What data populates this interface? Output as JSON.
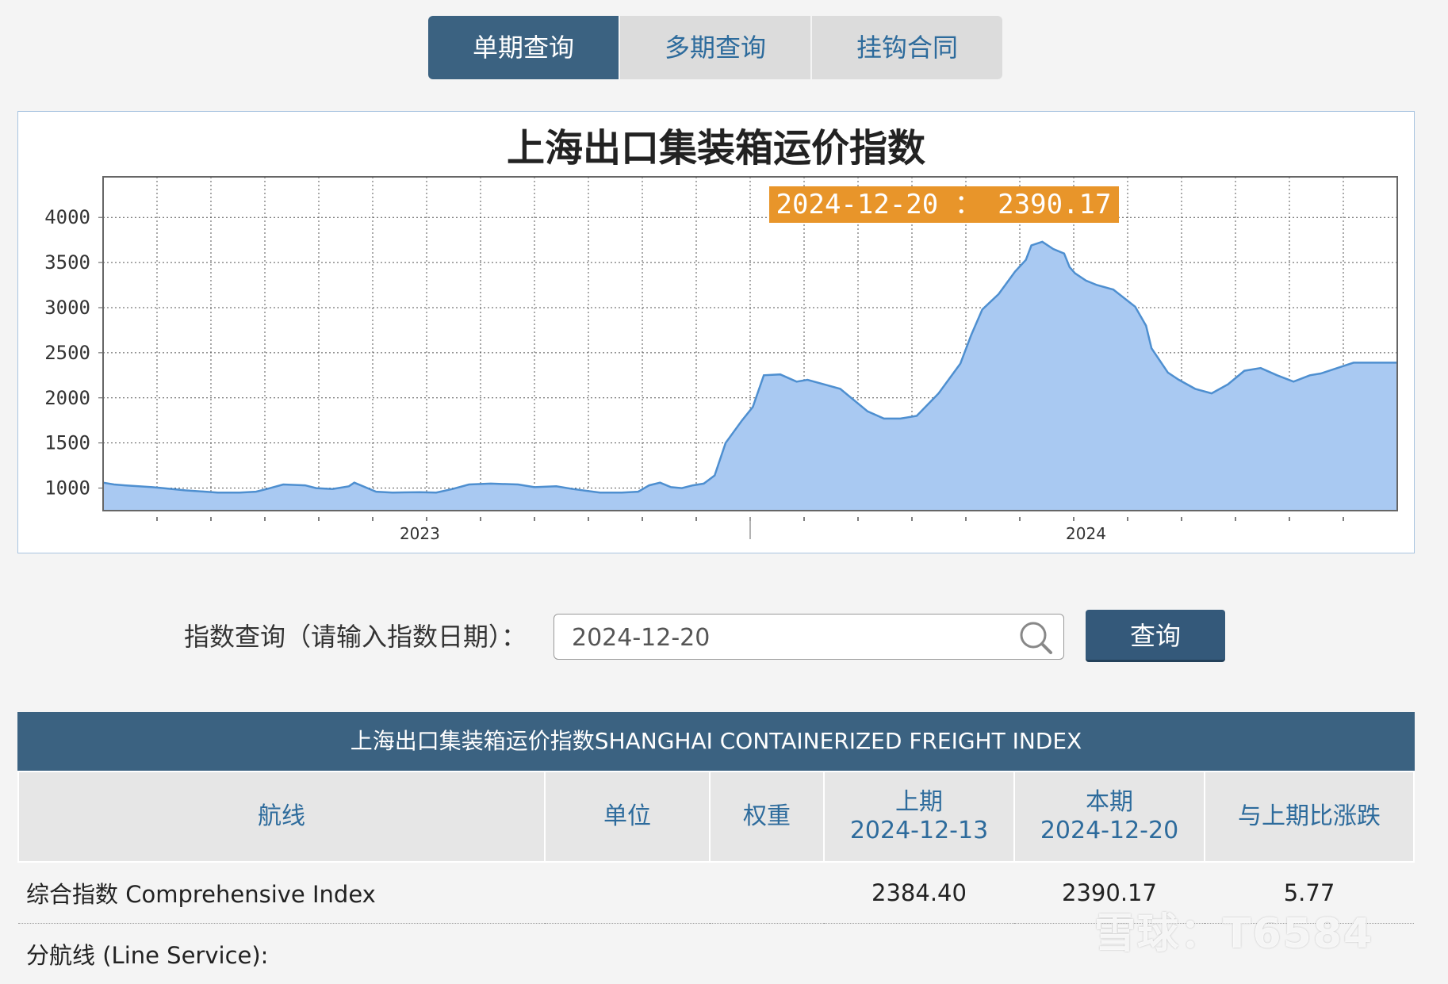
{
  "tabs": [
    {
      "label": "单期查询",
      "active": true
    },
    {
      "label": "多期查询",
      "active": false
    },
    {
      "label": "挂钩合同",
      "active": false
    }
  ],
  "chart_data": {
    "type": "area",
    "title": "上海出口集装箱运价指数",
    "tooltip": "2024-12-20 ： 2390.17",
    "yticks": [
      4000,
      3500,
      3000,
      2500,
      2000,
      1500,
      1000
    ],
    "ylim": [
      750,
      4450
    ],
    "xlim": [
      2022.62,
      2024.99
    ],
    "xticks": [
      {
        "label": "2023",
        "x": 2023.2
      },
      {
        "label": "2024",
        "x": 2024.42
      }
    ],
    "grid": true,
    "series_color": "#a9c9f2",
    "line_color": "#4e8fd0",
    "x": [
      2022.62,
      2022.64,
      2022.66,
      2022.71,
      2022.73,
      2022.77,
      2022.83,
      2022.87,
      2022.9,
      2022.92,
      2022.95,
      2022.99,
      2023.01,
      2023.04,
      2023.07,
      2023.08,
      2023.12,
      2023.15,
      2023.2,
      2023.23,
      2023.26,
      2023.29,
      2023.33,
      2023.38,
      2023.41,
      2023.45,
      2023.48,
      2023.53,
      2023.57,
      2023.6,
      2023.62,
      2023.64,
      2023.66,
      2023.68,
      2023.7,
      2023.72,
      2023.74,
      2023.76,
      2023.79,
      2023.81,
      2023.83,
      2023.86,
      2023.89,
      2023.91,
      2023.94,
      2023.97,
      2024.02,
      2024.05,
      2024.08,
      2024.11,
      2024.15,
      2024.19,
      2024.21,
      2024.23,
      2024.26,
      2024.29,
      2024.31,
      2024.32,
      2024.34,
      2024.36,
      2024.38,
      2024.39,
      2024.4,
      2024.42,
      2024.44,
      2024.47,
      2024.51,
      2024.53,
      2024.54,
      2024.57,
      2024.59,
      2024.62,
      2024.65,
      2024.68,
      2024.71,
      2024.74,
      2024.77,
      2024.8,
      2024.83,
      2024.85,
      2024.89,
      2024.91,
      2024.94,
      2024.95,
      2024.97,
      2024.99
    ],
    "values": [
      1060,
      1040,
      1030,
      1010,
      1000,
      975,
      950,
      950,
      960,
      990,
      1040,
      1030,
      1000,
      990,
      1020,
      1060,
      960,
      950,
      955,
      950,
      990,
      1040,
      1050,
      1040,
      1010,
      1020,
      990,
      950,
      950,
      960,
      1030,
      1060,
      1010,
      1000,
      1030,
      1050,
      1140,
      1500,
      1750,
      1900,
      2250,
      2260,
      2180,
      2200,
      2150,
      2100,
      1850,
      1770,
      1770,
      1800,
      2050,
      2380,
      2700,
      2980,
      3150,
      3400,
      3530,
      3690,
      3730,
      3650,
      3600,
      3450,
      3380,
      3300,
      3250,
      3200,
      3010,
      2800,
      2550,
      2280,
      2200,
      2100,
      2050,
      2150,
      2300,
      2330,
      2250,
      2180,
      2250,
      2270,
      2350,
      2390,
      2390,
      2390,
      2390,
      2390
    ]
  },
  "query": {
    "label": "指数查询（请输入指数日期）：",
    "value": "2024-12-20",
    "button": "查询"
  },
  "table": {
    "header": "上海出口集装箱运价指数SHANGHAI CONTAINERIZED FREIGHT INDEX",
    "columns": {
      "route": "航线",
      "unit": "单位",
      "weight": "权重",
      "prev_label": "上期",
      "prev_date": "2024-12-13",
      "curr_label": "本期",
      "curr_date": "2024-12-20",
      "change": "与上期比涨跌"
    },
    "rows": [
      {
        "name": "综合指数 Comprehensive Index",
        "prev": "2384.40",
        "curr": "2390.17",
        "change": "5.77"
      },
      {
        "name": "分航线 (Line Service):"
      }
    ]
  },
  "watermark": "雪球：T6584"
}
